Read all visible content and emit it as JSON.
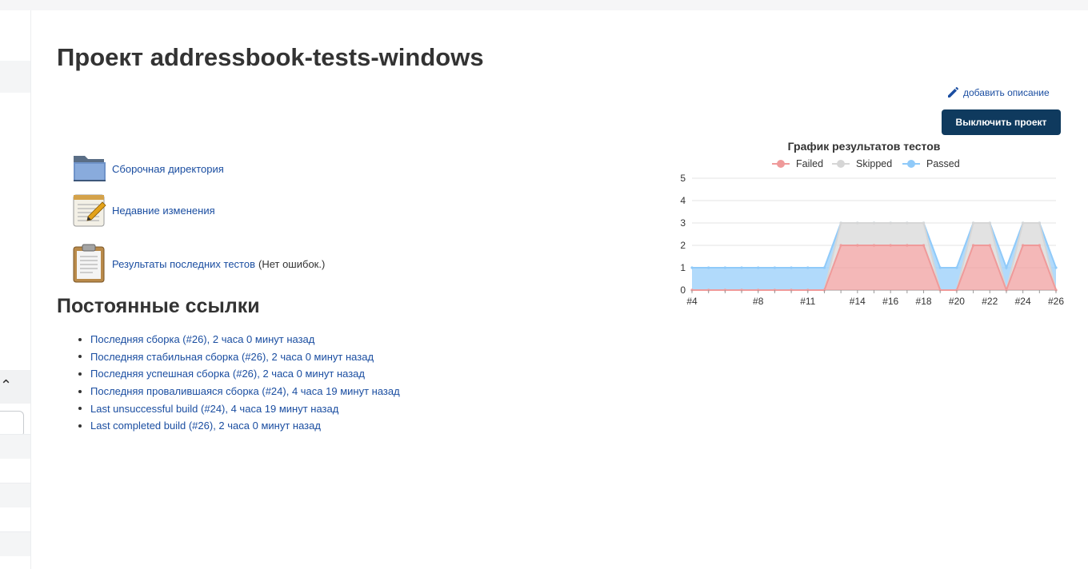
{
  "page": {
    "title": "Проект addressbook-tests-windows",
    "add_description": "добавить описание",
    "disable_button": "Выключить проект"
  },
  "tasks": [
    {
      "label": "Сборочная директория",
      "icon": "folder-icon"
    },
    {
      "label": "Недавние изменения",
      "icon": "notepad-icon"
    },
    {
      "label": "Результаты последних тестов",
      "note": "(Нет ошибок.)",
      "icon": "clipboard-icon"
    }
  ],
  "permalinks": {
    "title": "Постоянные ссылки",
    "items": [
      "Последняя сборка (#26), 2 часа 0 минут назад",
      "Последняя стабильная сборка (#26), 2 часа 0 минут назад",
      "Последняя успешная сборка (#26), 2 часа 0 минут назад",
      "Последняя провалившаяся сборка (#24), 4 часа 19 минут назад",
      "Last unsuccessful build (#24), 4 часа 19 минут назад",
      "Last completed build (#26), 2 часа 0 минут назад"
    ]
  },
  "chart_data": {
    "type": "area",
    "title": "График результатов тестов",
    "stacked": true,
    "legend_position": "top",
    "x": [
      "#4",
      "#5",
      "#6",
      "#7",
      "#8",
      "#9",
      "#10",
      "#11",
      "#12",
      "#13",
      "#14",
      "#15",
      "#16",
      "#17",
      "#18",
      "#19",
      "#20",
      "#21",
      "#22",
      "#23",
      "#24",
      "#25",
      "#26"
    ],
    "x_tick_labels": [
      "#4",
      "#8",
      "#11",
      "#14",
      "#16",
      "#18",
      "#20",
      "#22",
      "#24",
      "#26"
    ],
    "ylim": [
      0,
      5
    ],
    "y_ticks": [
      0,
      1,
      2,
      3,
      4,
      5
    ],
    "grid": true,
    "series": [
      {
        "name": "Failed",
        "color": "#ef9a9a",
        "values": [
          0,
          0,
          0,
          0,
          0,
          0,
          0,
          0,
          0,
          2,
          2,
          2,
          2,
          2,
          2,
          0,
          0,
          2,
          2,
          0,
          2,
          2,
          0
        ]
      },
      {
        "name": "Skipped",
        "color": "#d6d6d6",
        "values": [
          0,
          0,
          0,
          0,
          0,
          0,
          0,
          0,
          0,
          1,
          1,
          1,
          1,
          1,
          1,
          0,
          0,
          1,
          1,
          0,
          1,
          1,
          0
        ]
      },
      {
        "name": "Passed",
        "color": "#90caf9",
        "values": [
          1,
          1,
          1,
          1,
          1,
          1,
          1,
          1,
          1,
          0,
          0,
          0,
          0,
          0,
          0,
          1,
          1,
          0,
          0,
          1,
          0,
          0,
          1
        ]
      }
    ],
    "x_positions_note_removed": true,
    "x_index_of_builds": [
      4,
      5,
      6,
      7,
      8,
      9,
      10,
      11,
      12,
      13,
      14,
      15,
      16,
      17,
      18,
      19,
      20,
      21,
      22,
      23,
      24,
      25,
      26
    ]
  }
}
